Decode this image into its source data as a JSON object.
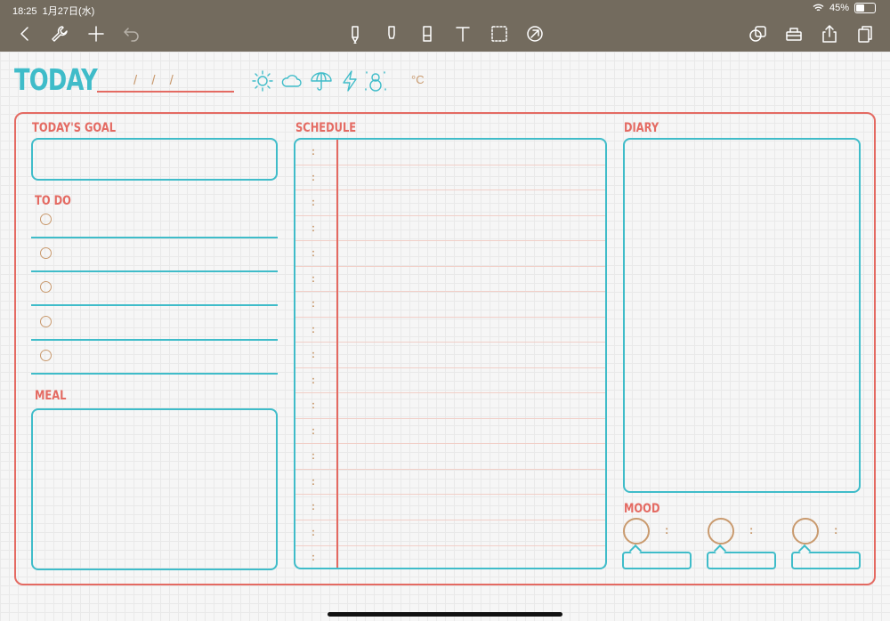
{
  "status_bar": {
    "time": "18:25",
    "date": "1月27日(水)",
    "battery": "45%",
    "battery_level": 0.45
  },
  "toolbar": {
    "left_icons": [
      "back-icon",
      "wrench-icon",
      "add-icon",
      "undo-icon"
    ],
    "tool_icons": [
      "pen-icon",
      "highlighter-icon",
      "eraser-icon",
      "text-icon",
      "lasso-icon",
      "shapes-icon"
    ],
    "right_icons": [
      "layers-icon",
      "tray-icon",
      "share-icon",
      "pages-icon"
    ]
  },
  "planner": {
    "title": "TODAY",
    "date_marks": "/ / /",
    "weather_icons": [
      "sun-icon",
      "cloud-icon",
      "umbrella-icon",
      "lightning-icon",
      "snowman-icon"
    ],
    "temperature_unit": "°C",
    "goal_label": "TODAY'S GOAL",
    "todo_label": "TO DO",
    "todo_count": 5,
    "meal_label": "MEAL",
    "schedule_label": "SCHEDULE",
    "schedule_colon": ":",
    "schedule_rows": 17,
    "diary_label": "DIARY",
    "mood_label": "MOOD",
    "mood_colon": ":",
    "mood_count": 3
  },
  "colors": {
    "accent_teal": "#3fbcc9",
    "accent_red": "#e46a62",
    "accent_tan": "#c99a6e",
    "toolbar_bg": "#736b5e"
  }
}
